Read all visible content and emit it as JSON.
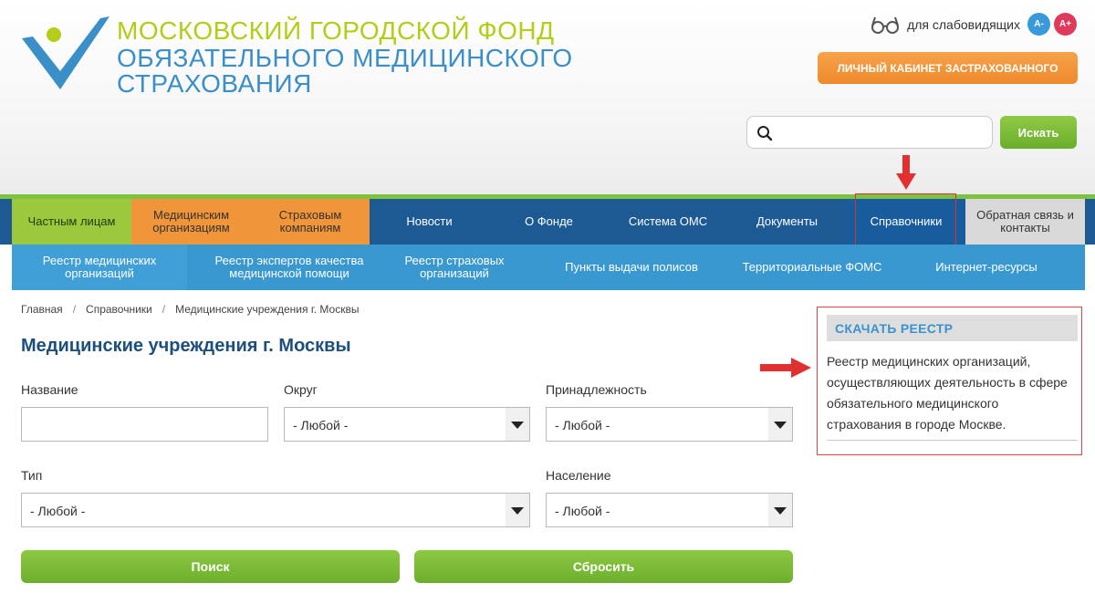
{
  "header": {
    "logo_lines": [
      "МОСКОВСКИЙ ГОРОДСКОЙ ФОНД",
      "ОБЯЗАТЕЛЬНОГО МЕДИЦИНСКОГО",
      "СТРАХОВАНИЯ"
    ],
    "a11y_label": "для слабовидящих",
    "font_minus": "A-",
    "font_plus": "A+",
    "cabinet_button": "ЛИЧНЫЙ КАБИНЕТ ЗАСТРАХОВАННОГО",
    "search_value": "",
    "search_button": "Искать"
  },
  "nav": {
    "items": [
      "Частным лицам",
      "Медицинским организациям",
      "Страховым компаниям",
      "Новости",
      "О Фонде",
      "Система ОМС",
      "Документы",
      "Справочники",
      "Обратная связь и контакты"
    ]
  },
  "subnav": {
    "items": [
      "Реестр медицинских организаций",
      "Реестр экспертов качества медицинской помощи",
      "Реестр страховых организаций",
      "Пункты выдачи полисов",
      "Территориальные ФОМС",
      "Интернет-ресурсы"
    ]
  },
  "breadcrumb": [
    "Главная",
    "Справочники",
    "Медицинские учреждения г. Москвы"
  ],
  "page_title": "Медицинские учреждения г. Москвы",
  "form": {
    "name_label": "Название",
    "name_value": "",
    "district_label": "Округ",
    "district_value": "- Любой -",
    "affiliation_label": "Принадлежность",
    "affiliation_value": "- Любой -",
    "type_label": "Тип",
    "type_value": "- Любой -",
    "population_label": "Население",
    "population_value": "- Любой -",
    "search_button": "Поиск",
    "reset_button": "Сбросить"
  },
  "sidebar": {
    "heading": "СКАЧАТЬ РЕЕСТР",
    "text": "Реестр медицинских организаций, осуществляющих деятельность в сфере обязательного медицинского страхования в городе Москве."
  },
  "colors": {
    "accent_green": "#7ec242",
    "accent_orange": "#f0953a",
    "nav_blue": "#1d5a93",
    "subnav_blue": "#3a98d0",
    "annotation_red": "#e03030"
  }
}
